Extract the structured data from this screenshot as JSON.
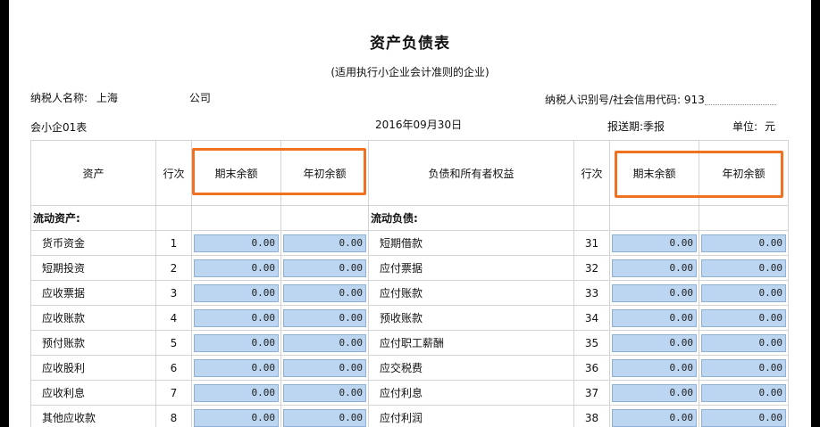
{
  "report": {
    "title": "资产负债表",
    "subtitle": "(适用执行小企业会计准则的企业)",
    "taxpayer_name_label": "纳税人名称:",
    "taxpayer_name_start": "上海",
    "taxpayer_name_end": "公司",
    "taxpayer_id_label": "纳税人识别号/社会信用代码:",
    "taxpayer_id_start": "913",
    "form_code": "会小企01表",
    "date": "2016年09月30日",
    "period_label": "报送期:",
    "period_value": "季报",
    "unit_label": "单位:",
    "unit_value": "元"
  },
  "columns": {
    "assets": "资产",
    "line_no": "行次",
    "end_balance": "期末余额",
    "begin_balance": "年初余额",
    "liabilities": "负债和所有者权益"
  },
  "sections": {
    "current_assets": "流动资产:",
    "current_liabilities": "流动负债:"
  },
  "rows": [
    {
      "asset": "货币资金",
      "aline": "1",
      "aend": "0.00",
      "abegin": "0.00",
      "liab": "短期借款",
      "lline": "31",
      "lend": "0.00",
      "lbegin": "0.00"
    },
    {
      "asset": "短期投资",
      "aline": "2",
      "aend": "0.00",
      "abegin": "0.00",
      "liab": "应付票据",
      "lline": "32",
      "lend": "0.00",
      "lbegin": "0.00"
    },
    {
      "asset": "应收票据",
      "aline": "3",
      "aend": "0.00",
      "abegin": "0.00",
      "liab": "应付账款",
      "lline": "33",
      "lend": "0.00",
      "lbegin": "0.00"
    },
    {
      "asset": "应收账款",
      "aline": "4",
      "aend": "0.00",
      "abegin": "0.00",
      "liab": "预收账款",
      "lline": "34",
      "lend": "0.00",
      "lbegin": "0.00"
    },
    {
      "asset": "预付账款",
      "aline": "5",
      "aend": "0.00",
      "abegin": "0.00",
      "liab": "应付职工薪酬",
      "lline": "35",
      "lend": "0.00",
      "lbegin": "0.00"
    },
    {
      "asset": "应收股利",
      "aline": "6",
      "aend": "0.00",
      "abegin": "0.00",
      "liab": "应交税费",
      "lline": "36",
      "lend": "0.00",
      "lbegin": "0.00"
    },
    {
      "asset": "应收利息",
      "aline": "7",
      "aend": "0.00",
      "abegin": "0.00",
      "liab": "应付利息",
      "lline": "37",
      "lend": "0.00",
      "lbegin": "0.00"
    },
    {
      "asset": "其他应收款",
      "aline": "8",
      "aend": "0.00",
      "abegin": "0.00",
      "liab": "应付利润",
      "lline": "38",
      "lend": "0.00",
      "lbegin": "0.00"
    }
  ],
  "colors": {
    "highlight": "#f07220",
    "input_fill": "#bcd6f2",
    "grid": "#d4d4d4"
  }
}
